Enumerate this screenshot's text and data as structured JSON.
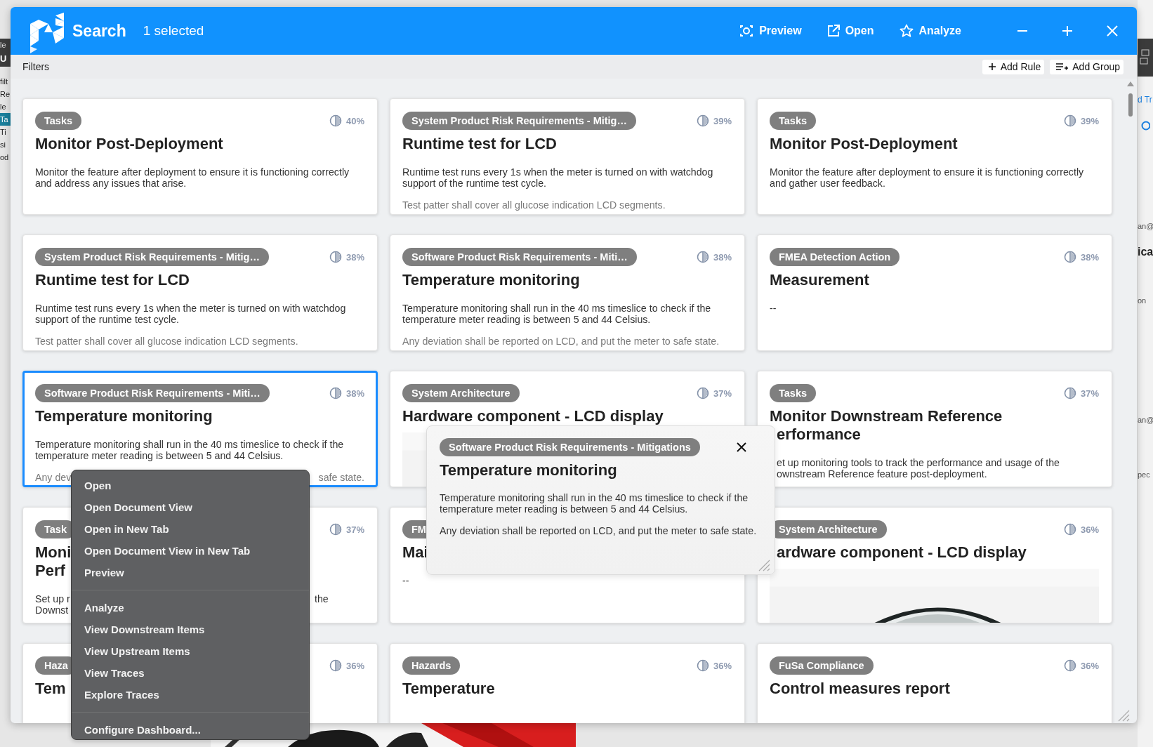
{
  "background_app": {
    "left_fragments": [
      {
        "text": "le",
        "kind": "band"
      },
      {
        "text": "U",
        "kind": "band-bold"
      },
      {
        "text": "filt",
        "kind": "plain"
      },
      {
        "text": "Re",
        "kind": "plain"
      },
      {
        "text": "le",
        "kind": "plain"
      },
      {
        "text": "Ta",
        "kind": "highlight"
      },
      {
        "text": "Ti",
        "kind": "plain"
      },
      {
        "text": "si",
        "kind": "plain"
      },
      {
        "text": "od",
        "kind": "plain"
      }
    ],
    "right_fragments": [
      {
        "text": "d Tr",
        "kind": "link"
      },
      {
        "text": "an@",
        "kind": "small"
      },
      {
        "text": "ica",
        "kind": "heading"
      },
      {
        "text": "on",
        "kind": "small"
      },
      {
        "text": "an@",
        "kind": "small"
      },
      {
        "text": "pec",
        "kind": "small"
      }
    ]
  },
  "dialog": {
    "title": "Search",
    "selection": "1 selected",
    "actions": [
      {
        "label": "Preview"
      },
      {
        "label": "Open"
      },
      {
        "label": "Analyze"
      }
    ],
    "window_buttons": [
      {
        "kind": "minimize"
      },
      {
        "kind": "maximize"
      },
      {
        "kind": "close"
      }
    ]
  },
  "filters": {
    "label": "Filters",
    "buttons": [
      {
        "label": "Add Rule"
      },
      {
        "label": "Add Group"
      }
    ]
  },
  "cards": [
    {
      "tag": "Tasks",
      "score": "40%",
      "title": "Monitor Post-Deployment",
      "description": "Monitor the feature after deployment to ensure it is functioning correctly and address any issues that arise.",
      "selected": false
    },
    {
      "tag": "System Product Risk Requirements - Mitig…",
      "score": "39%",
      "title": "Runtime test for LCD",
      "description": "Runtime test runs every 1s when the meter is turned on with watchdog support of the runtime test cycle.",
      "note": "Test patter shall cover all glucose indication LCD segments.",
      "selected": false
    },
    {
      "tag": "Tasks",
      "score": "39%",
      "title": "Monitor Post-Deployment",
      "description": "Monitor the feature after deployment to ensure it is functioning correctly and gather user feedback.",
      "selected": false
    },
    {
      "tag": "System Product Risk Requirements - Mitig…",
      "score": "38%",
      "title": "Runtime test for LCD",
      "description": "Runtime test runs every 1s when the meter is turned on with watchdog support of the runtime test cycle.",
      "note": "Test patter shall cover all glucose indication LCD segments.",
      "selected": false
    },
    {
      "tag": "Software Product Risk Requirements - Miti…",
      "score": "38%",
      "title": "Temperature monitoring",
      "description": "Temperature monitoring shall run in the 40 ms timeslice to check if the temperature meter reading is between 5 and 44 Celsius.",
      "note": "Any deviation shall be reported on LCD, and put the meter to safe state.",
      "selected": false
    },
    {
      "tag": "FMEA Detection Action",
      "score": "38%",
      "title": "Measurement",
      "description": "--",
      "selected": false
    },
    {
      "tag": "Software Product Risk Requirements - Miti…",
      "score": "38%",
      "title": "Temperature monitoring",
      "description": "Temperature monitoring shall run in the 40 ms timeslice to check if the temperature meter reading is between 5 and 44 Celsius.",
      "note": "Any dev",
      "note_right": "safe state.",
      "selected": true
    },
    {
      "tag": "System Architecture",
      "score": "37%",
      "title": "Hardware component - LCD display",
      "kind": "picture",
      "selected": false
    },
    {
      "tag": "Tasks",
      "score": "37%",
      "title": "Monitor Downstream Reference",
      "title_continued": "erformance",
      "description": "et up monitoring tools to track the performance and usage of the\nownstream Reference feature post-deployment.",
      "overlapped": true,
      "selected": false
    },
    {
      "tag": "Task",
      "score": "37%",
      "title": "Moni\nPerf",
      "description": "Set up r\nDownst",
      "description_right": "the",
      "selected": false
    },
    {
      "tag": "FM",
      "title": "Mai",
      "description": "--",
      "selected": false
    },
    {
      "tag": "System Architecture",
      "score": "36%",
      "title": "ardware component - LCD display",
      "kind": "picture",
      "overlapped": true,
      "selected": false
    },
    {
      "tag": "Haza",
      "score": "36%",
      "title": "Tem",
      "selected": false
    },
    {
      "tag": "Hazards",
      "score": "36%",
      "title": "Temperature",
      "selected": false
    },
    {
      "tag": "FuSa Compliance",
      "score": "36%",
      "title": "Control measures report",
      "selected": false
    }
  ],
  "preview_popup": {
    "tag": "Software Product Risk Requirements - Mitigations",
    "title": "Temperature monitoring",
    "description": "Temperature monitoring shall run in the 40 ms timeslice to check if the temperature meter reading is between 5 and 44 Celsius.",
    "note": "Any deviation shall be reported on LCD, and put the meter to safe state."
  },
  "context_menu": {
    "groups": [
      [
        "Open",
        "Open Document View",
        "Open in New Tab",
        "Open Document View in New Tab",
        "Preview"
      ],
      [
        "Analyze",
        "View Downstream Items",
        "View Upstream Items",
        "View Traces",
        "Explore Traces"
      ],
      [
        "Configure Dashboard..."
      ]
    ]
  }
}
